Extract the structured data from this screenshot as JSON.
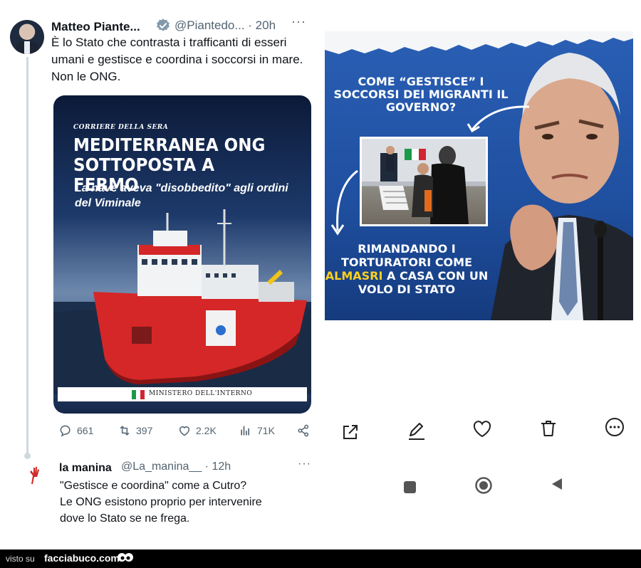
{
  "tweet": {
    "author_name": "Matteo Piante...",
    "author_handle": "@Piantedo...",
    "time": "· 20h",
    "more": "···",
    "text": "È lo Stato che contrasta i trafficanti di esseri umani e gestisce e coordina i soccorsi in mare. Non le ONG.",
    "card": {
      "paper": "CORRIERE DELLA SERA",
      "headline": "MEDITERRANEA ONG SOTTOPOSTA A FERMO",
      "subheadline": "La nave aveva \"disobbedito\" agli ordini del Viminale",
      "ministry": "MINISTERO DELL'INTERNO"
    },
    "actions": {
      "replies": "661",
      "retweets": "397",
      "likes": "2.2K",
      "views": "71K"
    }
  },
  "reply": {
    "author_name": "la manina",
    "author_handle": "@La_manina__",
    "time": "· 12h",
    "more": "···",
    "text_line1": "\"Gestisce e coordina\" come a Cutro?",
    "text_line2": "Le ONG esistono proprio per intervenire",
    "text_line3": "dove lo Stato se ne frega."
  },
  "right_card": {
    "question": "COME “GESTISCE” I SOCCORSI DEI MIGRANTI IL GOVERNO?",
    "answer_part1": "RIMANDANDO I TORTURATORI COME ",
    "answer_highlight": "ALMASRI",
    "answer_part2": " A CASA CON UN VOLO DI STATO"
  },
  "right_actions": {
    "icons": [
      "share-icon",
      "edit-icon",
      "heart-icon",
      "trash-icon",
      "more-icon"
    ]
  },
  "navbar": {
    "icons": [
      "recents-icon",
      "home-icon",
      "back-icon"
    ]
  },
  "footer": {
    "visto": "visto su",
    "site": "facciabuco.com"
  }
}
